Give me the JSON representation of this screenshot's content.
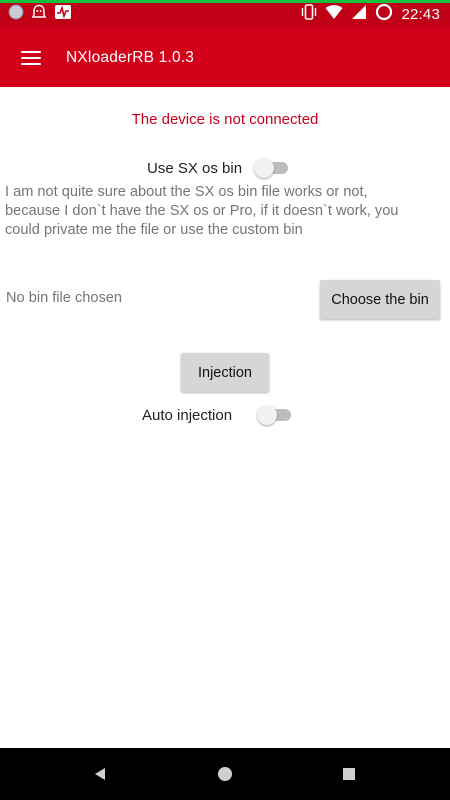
{
  "status_bar": {
    "time": "22:43",
    "left_icons": [
      "notification-dot-icon",
      "app-notification-icon",
      "activity-icon"
    ],
    "right_icons": [
      "vibrate-icon",
      "wifi-icon",
      "signal-icon",
      "data-saver-icon"
    ]
  },
  "app_bar": {
    "title": "NXloaderRB 1.0.3",
    "background": "#d3001a"
  },
  "main": {
    "connection_status": "The device is not connected",
    "connection_status_color": "#c8001c",
    "sx_switch_label": "Use SX os bin",
    "sx_switch_on": false,
    "note": "I am not quite sure about the SX os bin file works or not, because I don`t have the SX os or Pro, if it doesn`t work, you could private me the file or use the custom bin",
    "bin_status": "No bin file chosen",
    "choose_bin_label": "Choose the bin",
    "injection_label": "Injection",
    "auto_injection_label": "Auto injection",
    "auto_injection_on": false
  },
  "nav_bar": {
    "items": [
      "back-icon",
      "home-icon",
      "recents-icon"
    ]
  }
}
